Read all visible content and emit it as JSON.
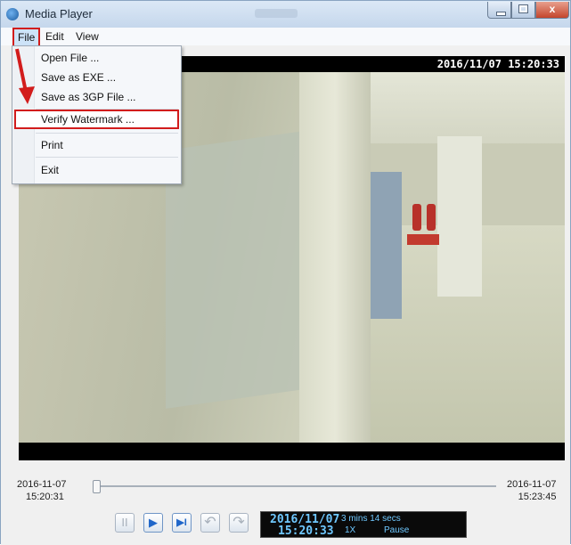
{
  "window": {
    "title": "Media Player",
    "controls": {
      "minimize": "",
      "maximize": "",
      "close": "x"
    }
  },
  "menubar": {
    "items": [
      "File",
      "Edit",
      "View"
    ]
  },
  "file_menu": {
    "items": [
      "Open File ...",
      "Save as EXE ...",
      "Save as 3GP File ...",
      "Verify Watermark ...",
      "Print",
      "Exit"
    ],
    "highlighted_item": "Verify Watermark ..."
  },
  "video": {
    "osd_timestamp": "2016/11/07 15:20:33"
  },
  "timeline": {
    "start_date": "2016-11-07",
    "start_time": "15:20:31",
    "end_date": "2016-11-07",
    "end_time": "15:23:45",
    "position": 0.0
  },
  "controls": {
    "pause_icon": "II",
    "play_icon": "▶",
    "step_icon": "▶I",
    "rewind_icon": "↶",
    "forward_icon": "↷"
  },
  "status": {
    "date": "2016/11/07",
    "time": "15:20:33",
    "duration": "3 mins 14 secs",
    "speed": "1X",
    "state": "Pause"
  },
  "colors": {
    "highlight_red": "#d21c1c",
    "status_text": "#6fc8ff",
    "title_bar": "#c5d7ec"
  }
}
